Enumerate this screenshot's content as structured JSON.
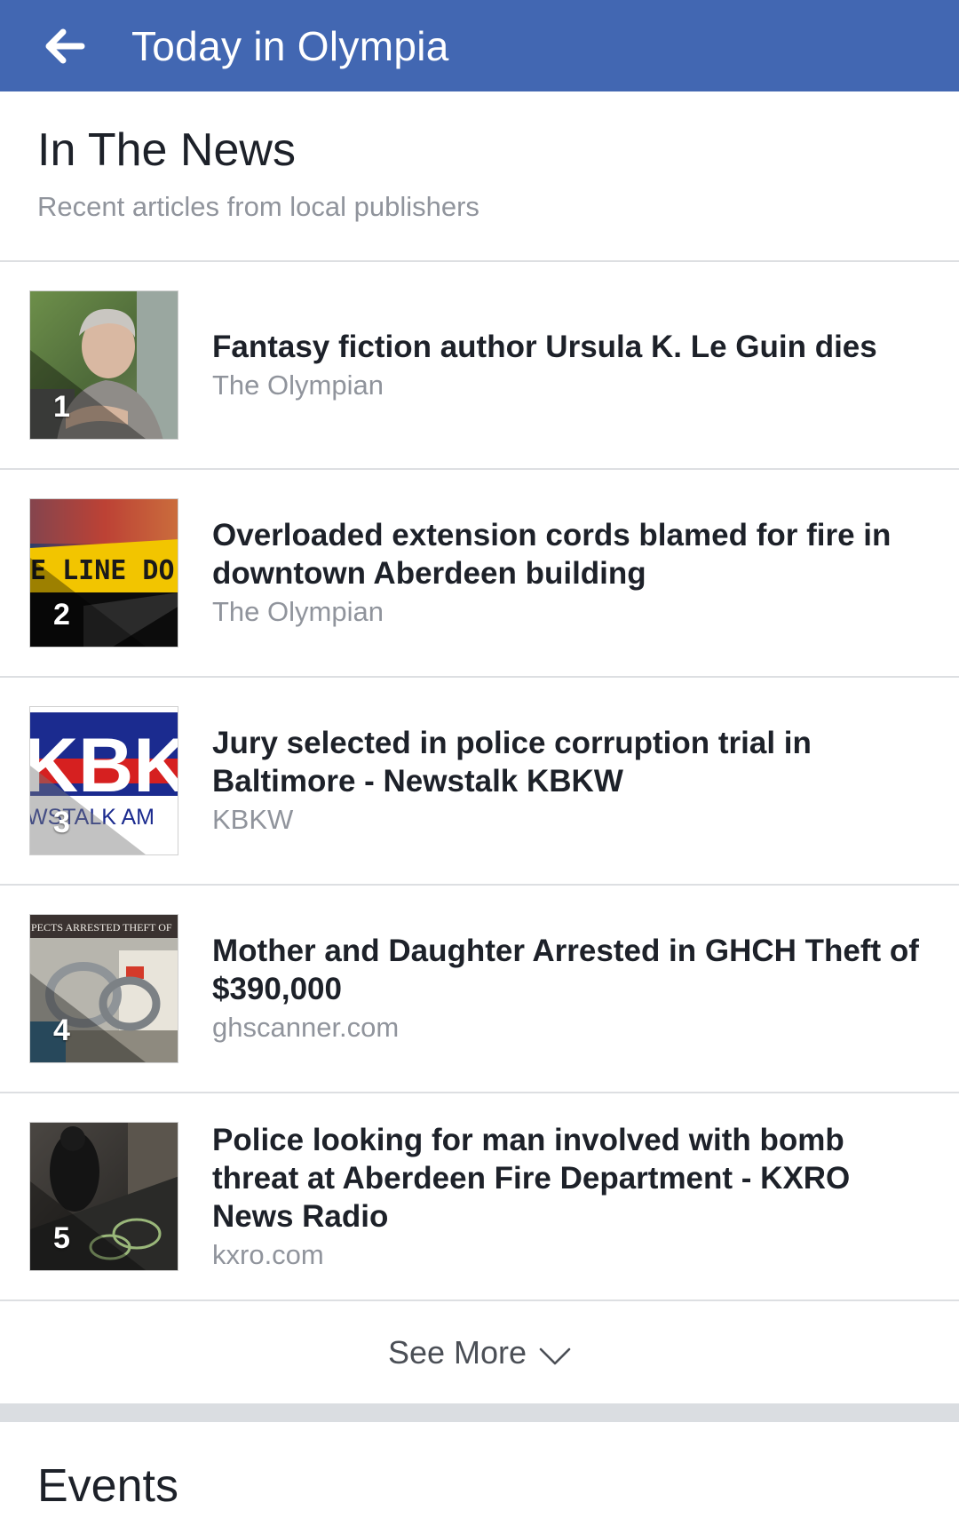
{
  "appbar": {
    "title": "Today in Olympia",
    "back_icon": "arrow-left-icon",
    "background": "#4267b2"
  },
  "news": {
    "title": "In The News",
    "subtitle": "Recent articles from local publishers",
    "articles": [
      {
        "rank": "1",
        "title": "Fantasy fiction author Ursula K. Le Guin dies",
        "source": "The Olympian",
        "thumb": "portrait-photo"
      },
      {
        "rank": "2",
        "title": "Overloaded extension cords blamed for fire in downtown Aberdeen building",
        "source": "The Olympian",
        "thumb": "police-tape-photo",
        "thumb_text": "E LINE DO NOT CR"
      },
      {
        "rank": "3",
        "title": "Jury selected in police corruption trial in Baltimore - Newstalk KBKW",
        "source": "KBKW",
        "thumb": "kbkw-logo",
        "thumb_text": "KBKW",
        "thumb_subtext": "WSTALK AM"
      },
      {
        "rank": "4",
        "title": "Mother and Daughter Arrested in GHCH Theft of $390,000",
        "source": "ghscanner.com",
        "thumb": "handcuffs-photo",
        "thumb_text": "PECTS ARRESTED THEFT OF"
      },
      {
        "rank": "5",
        "title": "Police looking for man involved with bomb threat at Aberdeen Fire Department - KXRO News Radio",
        "source": "kxro.com",
        "thumb": "surveillance-photo"
      }
    ],
    "see_more_label": "See More",
    "see_more_icon": "chevron-down-icon"
  },
  "events": {
    "title": "Events"
  }
}
